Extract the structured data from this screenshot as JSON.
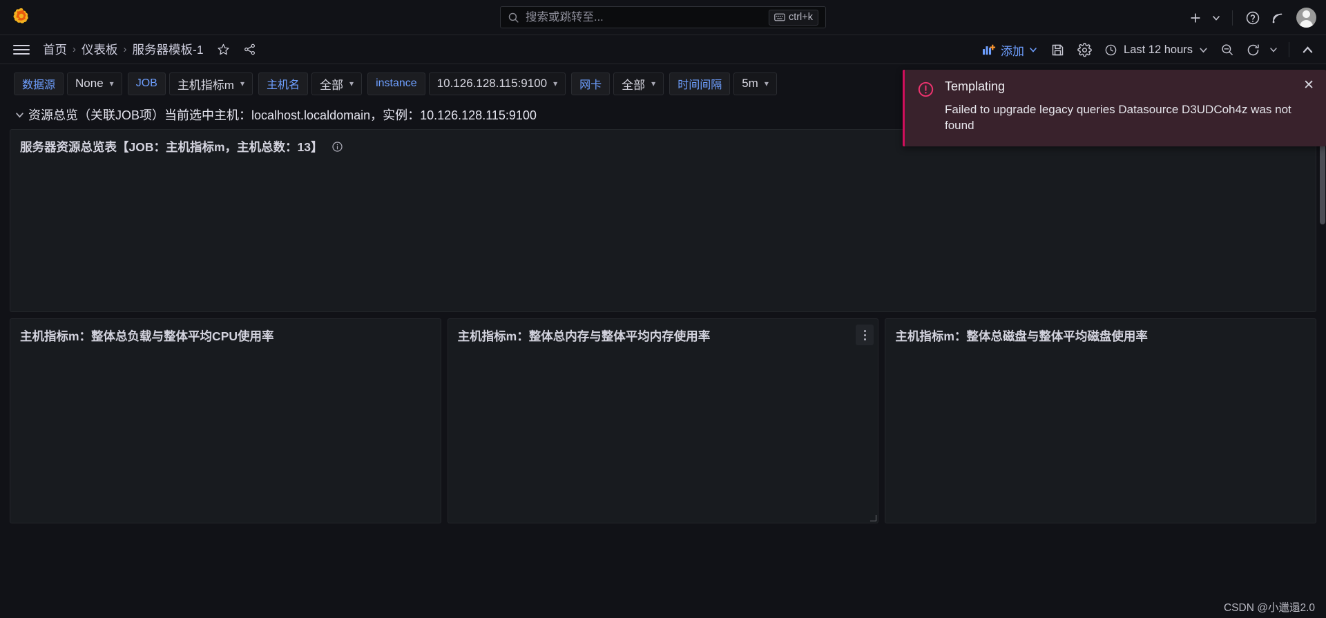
{
  "topnav": {
    "logo_icon": "grafana-logo",
    "search": {
      "placeholder": "搜索或跳转至...",
      "value": "",
      "icon": "search-icon",
      "shortcut": "ctrl+k",
      "shortcut_icon": "keyboard-icon"
    },
    "actions": {
      "new_icon": "plus-icon",
      "new_caret": "chevron-down-icon",
      "help_icon": "question-circle-icon",
      "news_icon": "rss-icon",
      "avatar_icon": "user-avatar"
    }
  },
  "breadcrumb": {
    "menu_icon": "hamburger-menu-icon",
    "items": [
      {
        "label": "首页"
      },
      {
        "label": "仪表板"
      },
      {
        "label": "服务器模板-1"
      }
    ],
    "separator": "›",
    "star_icon": "star-icon",
    "share_icon": "share-icon"
  },
  "toolbar": {
    "add_label": "添加",
    "add_icon": "add-panel-icon",
    "add_caret": "chevron-down-icon",
    "save_icon": "save-icon",
    "settings_icon": "gear-icon",
    "time_range": "Last 12 hours",
    "time_icon": "clock-icon",
    "time_caret": "chevron-down-icon",
    "zoom_out_icon": "zoom-out-icon",
    "refresh_icon": "refresh-icon",
    "refresh_caret": "chevron-down-icon",
    "collapse_icon": "chevron-up-icon"
  },
  "variables": [
    {
      "label": "数据源",
      "value": "None",
      "caret": "chevron-down-icon"
    },
    {
      "label": "JOB",
      "value": "主机指标m",
      "caret": "chevron-down-icon"
    },
    {
      "label": "主机名",
      "value": "全部",
      "caret": "chevron-down-icon"
    },
    {
      "label": "instance",
      "value": "10.126.128.115:9100",
      "caret": "chevron-down-icon"
    },
    {
      "label": "网卡",
      "value": "全部",
      "caret": "chevron-down-icon"
    },
    {
      "label": "时间间隔",
      "value": "5m",
      "caret": "chevron-down-icon"
    }
  ],
  "row": {
    "caret": "chevron-down-icon",
    "title": "资源总览（关联JOB项）当前选中主机：localhost.localdomain，实例：10.126.128.115:9100"
  },
  "panels": {
    "overview": {
      "title": "服务器资源总览表【JOB：主机指标m，主机总数：13】",
      "info_icon": "info-circle-icon"
    },
    "bottom": [
      {
        "title": "主机指标m：整体总负载与整体平均CPU使用率",
        "menu_icon": "panel-menu-icon"
      },
      {
        "title": "主机指标m：整体总内存与整体平均内存使用率",
        "menu_icon": "panel-menu-icon"
      },
      {
        "title": "主机指标m：整体总磁盘与整体平均磁盘使用率",
        "menu_icon": "panel-menu-icon"
      }
    ]
  },
  "alert": {
    "icon": "error-exclamation-icon",
    "title": "Templating",
    "message": "Failed to upgrade legacy queries Datasource D3UDCoh4z was not found",
    "close_icon": "close-icon",
    "accent_color": "#d10e5c",
    "background_color": "#39222c"
  },
  "watermark": "CSDN @小邋遢2.0"
}
